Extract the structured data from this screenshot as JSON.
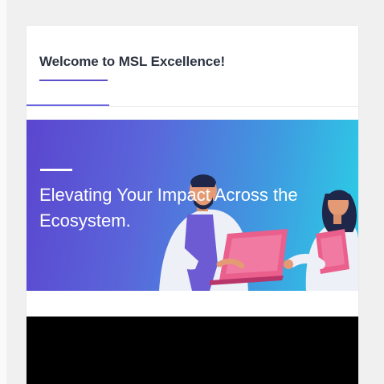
{
  "card": {
    "title": "Welcome to MSL Excellence!"
  },
  "banner": {
    "headline": "Elevating Your Impact Across the Ecosystem."
  },
  "colors": {
    "accent": "#5b4fc8",
    "banner_gradient_start": "#5b46cf",
    "banner_gradient_end": "#2bd0e6",
    "video_background": "#000000"
  }
}
